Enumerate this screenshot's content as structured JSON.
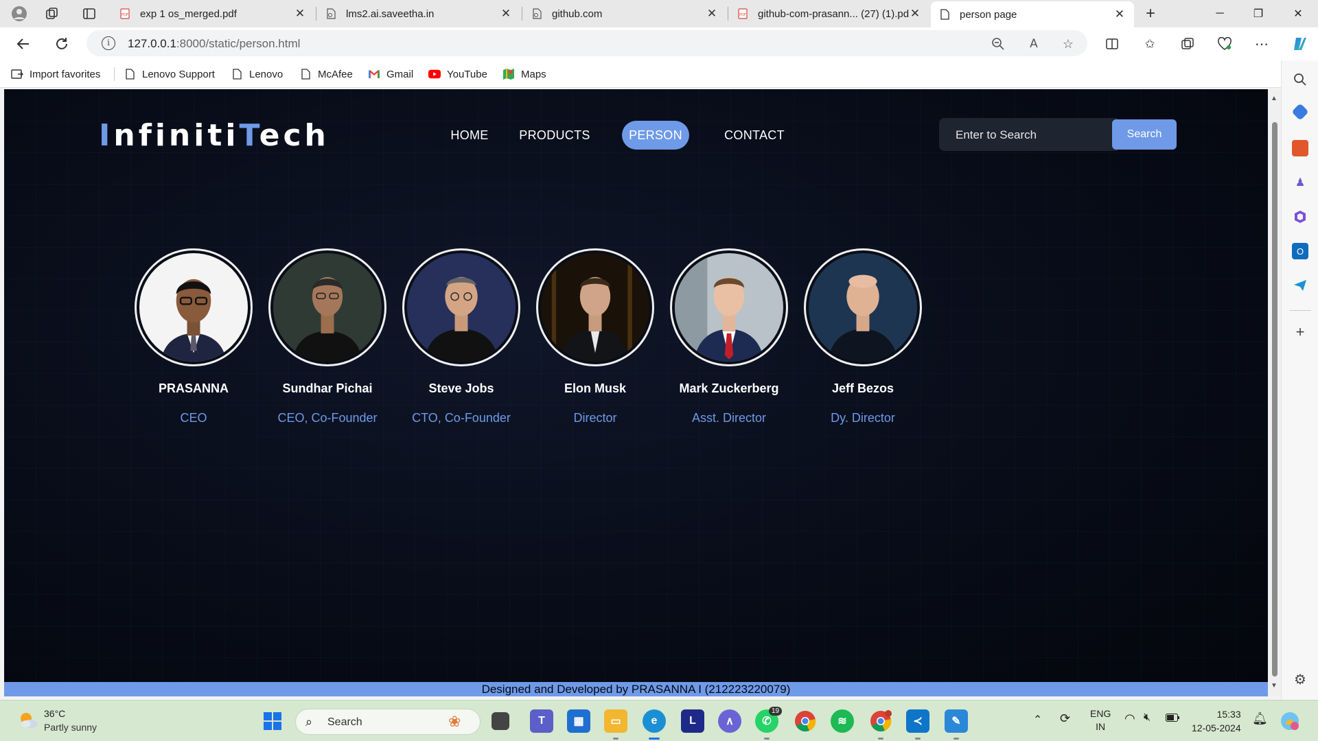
{
  "browser": {
    "tabs": [
      {
        "title": "exp 1 os_merged.pdf",
        "icon": "pdf-icon"
      },
      {
        "title": "lms2.ai.saveetha.in",
        "icon": "page-icon"
      },
      {
        "title": "github.com",
        "icon": "page-icon"
      },
      {
        "title": "github-com-prasann... (27) (1).pdf",
        "icon": "pdf-icon"
      },
      {
        "title": "person page",
        "icon": "document-icon",
        "active": true
      }
    ],
    "url_host": "127.0.0.1",
    "url_path": ":8000/static/person.html",
    "bookmarks": [
      "Import favorites",
      "Lenovo Support",
      "Lenovo",
      "McAfee",
      "Gmail",
      "YouTube",
      "Maps"
    ]
  },
  "site": {
    "logo_first_initial": "I",
    "logo_first_rest": "nfiniti",
    "logo_second_initial": "T",
    "logo_second_rest": "ech",
    "nav": [
      {
        "label": "HOME"
      },
      {
        "label": "PRODUCTS"
      },
      {
        "label": "PERSON",
        "active": true
      },
      {
        "label": "CONTACT"
      }
    ],
    "search_placeholder": "Enter to Search",
    "search_button": "Search",
    "people": [
      {
        "name": "PRASANNA",
        "role": "CEO"
      },
      {
        "name": "Sundhar Pichai",
        "role": "CEO, Co-Founder"
      },
      {
        "name": "Steve Jobs",
        "role": "CTO, Co-Founder"
      },
      {
        "name": "Elon Musk",
        "role": "Director"
      },
      {
        "name": "Mark Zuckerberg",
        "role": "Asst. Director"
      },
      {
        "name": "Jeff Bezos",
        "role": "Dy. Director"
      }
    ],
    "footer": "Designed and Developed by PRASANNA I (212223220079)",
    "accent_color": "#6e9ae8"
  },
  "taskbar": {
    "temperature": "36°C",
    "weather": "Partly sunny",
    "search_label": "Search",
    "whatsapp_badge": "19",
    "lang_1": "ENG",
    "lang_2": "IN",
    "time": "15:33",
    "date": "12-05-2024"
  }
}
